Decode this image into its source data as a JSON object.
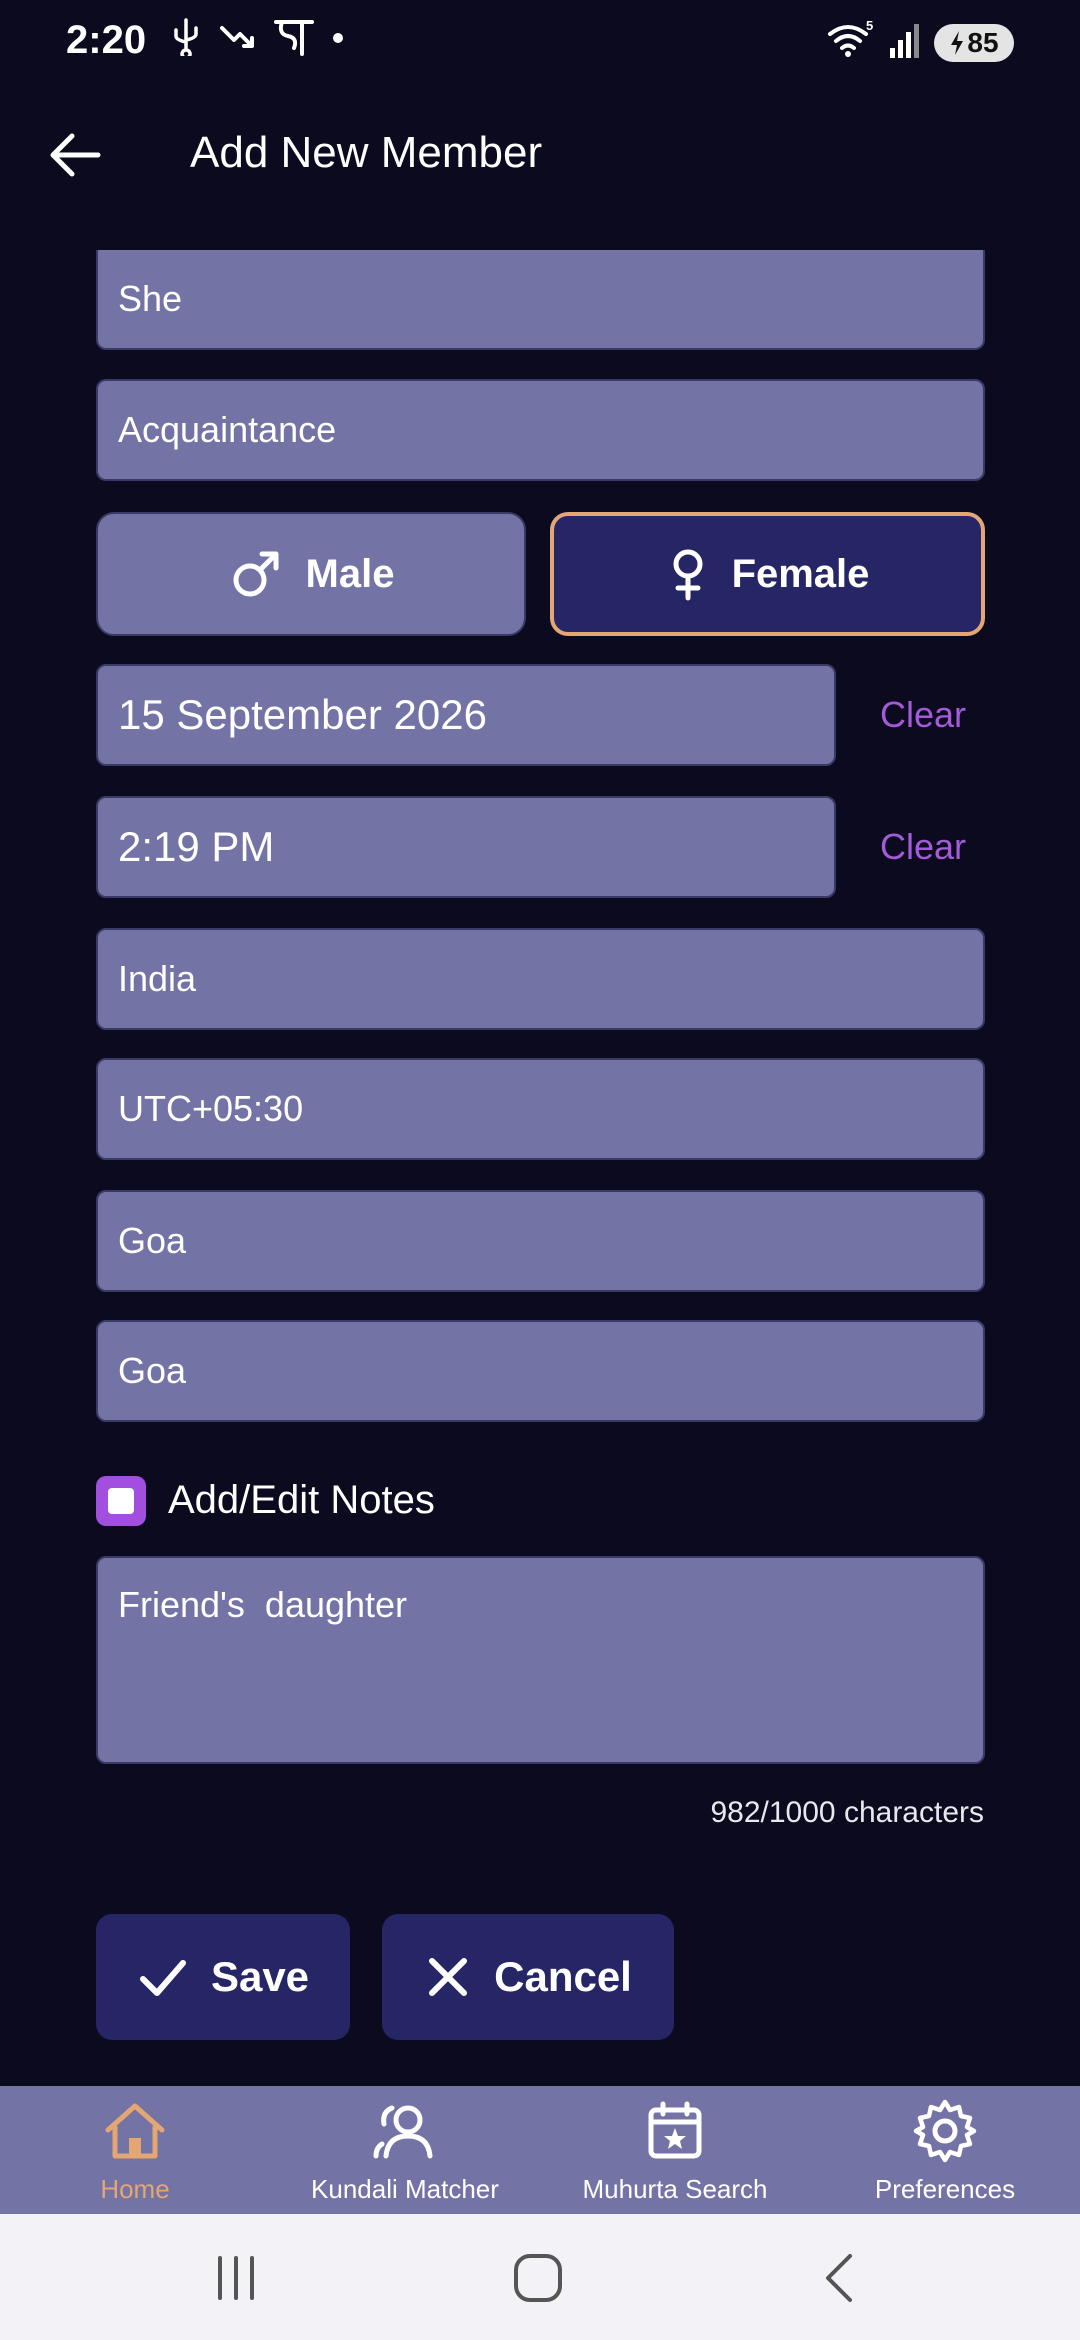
{
  "status": {
    "time": "2:20",
    "battery": "85",
    "wifi_badge": "5"
  },
  "header": {
    "title": "Add New Member"
  },
  "form": {
    "pronoun": "She",
    "relation": "Acquaintance",
    "gender": {
      "male_label": "Male",
      "female_label": "Female",
      "selected": "Female"
    },
    "date": "15 September 2026",
    "time": "2:19 PM",
    "clear_label": "Clear",
    "country": "India",
    "timezone": "UTC+05:30",
    "state": "Goa",
    "city": "Goa",
    "notes_checkbox_label": "Add/Edit Notes",
    "notes": "Friend's  daughter",
    "char_count": "982/1000 characters"
  },
  "actions": {
    "save_label": "Save",
    "cancel_label": "Cancel"
  },
  "nav": {
    "items": [
      {
        "label": "Home",
        "icon": "home-icon",
        "active": true
      },
      {
        "label": "Kundali Matcher",
        "icon": "people-icon",
        "active": false
      },
      {
        "label": "Muhurta Search",
        "icon": "calendar-star-icon",
        "active": false
      },
      {
        "label": "Preferences",
        "icon": "gear-icon",
        "active": false
      }
    ]
  },
  "colors": {
    "accent_orange": "#e4a672",
    "accent_purple": "#a35bd8",
    "field_bg": "#7373a6",
    "button_bg": "#262566",
    "background": "#0b0a1e"
  }
}
